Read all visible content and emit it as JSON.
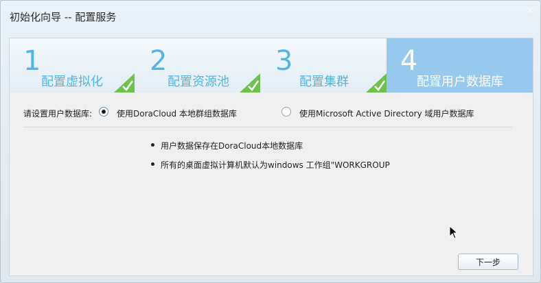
{
  "window": {
    "title": "初始化向导 -- 配置服务",
    "close_glyph": "×"
  },
  "steps": [
    {
      "number": "1",
      "label": "配置虚拟化",
      "completed": true
    },
    {
      "number": "2",
      "label": "配置资源池",
      "completed": true
    },
    {
      "number": "3",
      "label": "配置集群",
      "completed": true
    },
    {
      "number": "4",
      "label": "配置用户数据库",
      "completed": false,
      "active": true
    }
  ],
  "db_setting": {
    "label": "请设置用户数据库:",
    "options": [
      {
        "label": "使用DoraCloud 本地群组数据库",
        "selected": true
      },
      {
        "label": "使用Microsoft Active Directory 域用户数据库",
        "selected": false
      }
    ]
  },
  "info": [
    "用户数据保存在DoraCloud本地数据库",
    "所有的桌面虚拟计算机默认为windows 工作组\"WORKGROUP"
  ],
  "buttons": {
    "next_label": "下一步"
  },
  "colors": {
    "step_accent": "#4fb6e6",
    "active_step_bg": "#97c9ee",
    "check_green": "#6cc24a"
  }
}
